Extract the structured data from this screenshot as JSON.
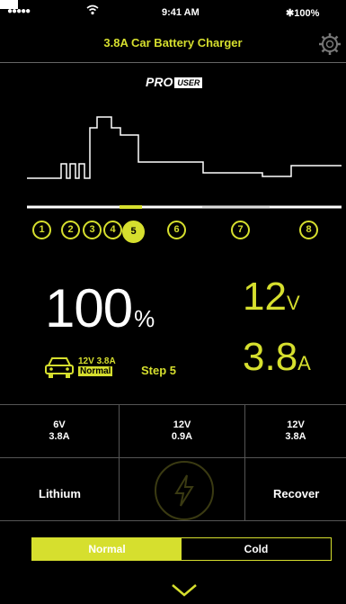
{
  "status_bar": {
    "signal": "●●●●●",
    "time": "9:41 AM",
    "battery": "100%"
  },
  "header": {
    "title": "3.8A Car Battery Charger"
  },
  "logo": {
    "pro": "PRO",
    "user": "USER"
  },
  "steps": [
    "1",
    "2",
    "3",
    "4",
    "5",
    "6",
    "7",
    "8"
  ],
  "active_step": "5",
  "readout": {
    "percent": "100",
    "percent_unit": "%",
    "voltage": "12",
    "voltage_unit": "V",
    "current": "3.8",
    "current_unit": "A",
    "mode_line1": "12V 3.8A",
    "mode_line2": "Normal",
    "step_label": "Step 5"
  },
  "presets": [
    {
      "v": "6V",
      "a": "3.8A"
    },
    {
      "v": "12V",
      "a": "0.9A"
    },
    {
      "v": "12V",
      "a": "3.8A"
    }
  ],
  "modes": {
    "left": "Lithium",
    "right": "Recover"
  },
  "toggle": {
    "normal": "Normal",
    "cold": "Cold"
  },
  "colors": {
    "accent": "#d6df2e",
    "background": "#000000"
  }
}
